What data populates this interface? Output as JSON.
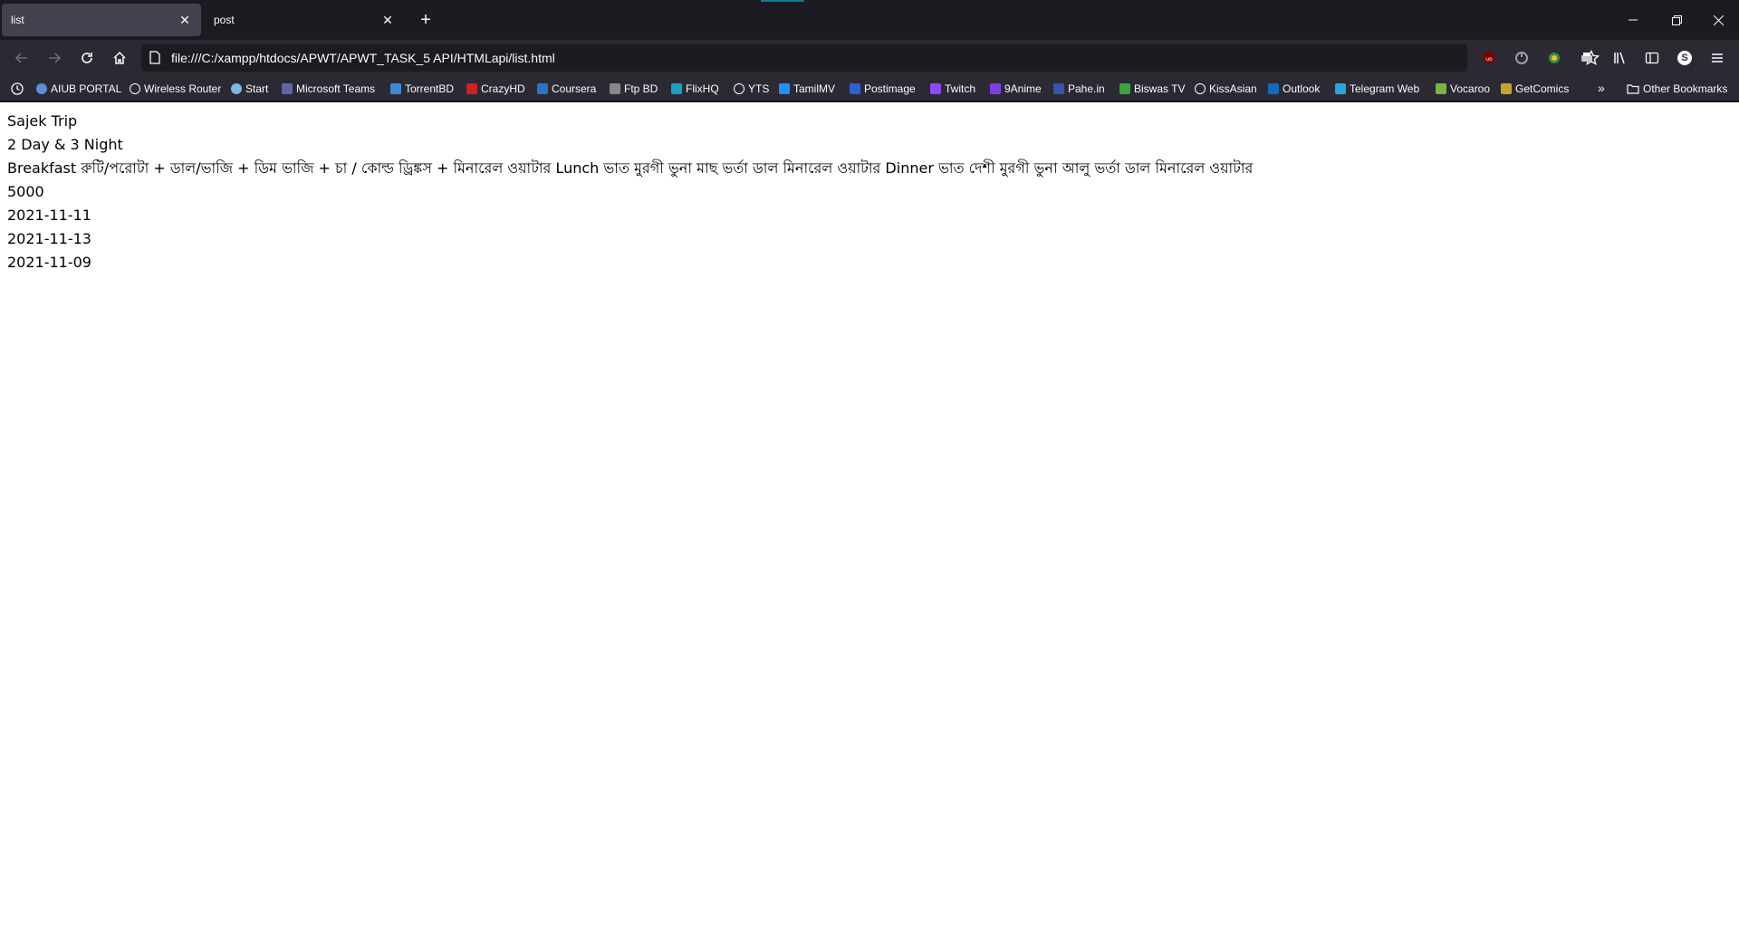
{
  "tabs": [
    {
      "title": "list",
      "active": true
    },
    {
      "title": "post",
      "active": false
    }
  ],
  "url": "file:///C:/xampp/htdocs/APWT/APWT_TASK_5 API/HTMLapi/list.html",
  "bookmarks": [
    {
      "label": "AIUB PORTAL",
      "icon": "shield-icon",
      "color": "#5b8fd6"
    },
    {
      "label": "Wireless Router",
      "icon": "globe-icon",
      "color": "#fbfbfe"
    },
    {
      "label": "Start",
      "icon": "shield-icon",
      "color": "#7fb6e8"
    },
    {
      "label": "Microsoft Teams",
      "icon": "teams-icon",
      "color": "#6264a7"
    },
    {
      "label": "TorrentBD",
      "icon": "torrentbd-icon",
      "color": "#3b8ad9"
    },
    {
      "label": "CrazyHD",
      "icon": "crazyhd-icon",
      "color": "#cc2222"
    },
    {
      "label": "Coursera",
      "icon": "coursera-icon",
      "color": "#2a73cc"
    },
    {
      "label": "Ftp BD",
      "icon": "ftpbd-icon",
      "color": "#888888"
    },
    {
      "label": "FlixHQ",
      "icon": "flixhq-icon",
      "color": "#1ba1c4"
    },
    {
      "label": "YTS",
      "icon": "globe-icon",
      "color": "#fbfbfe"
    },
    {
      "label": "TamilMV",
      "icon": "tamilmv-icon",
      "color": "#1e90ff"
    },
    {
      "label": "Postimage",
      "icon": "postimage-icon",
      "color": "#2f5fd0"
    },
    {
      "label": "Twitch",
      "icon": "twitch-icon",
      "color": "#9146ff"
    },
    {
      "label": "9Anime",
      "icon": "play-icon",
      "color": "#7b3fe4"
    },
    {
      "label": "Pahe.in",
      "icon": "pahe-icon",
      "color": "#3355aa"
    },
    {
      "label": "Biswas TV",
      "icon": "biswastv-icon",
      "color": "#3aa53a"
    },
    {
      "label": "KissAsian",
      "icon": "globe-icon",
      "color": "#fbfbfe"
    },
    {
      "label": "Outlook",
      "icon": "outlook-icon",
      "color": "#0f6cbd"
    },
    {
      "label": "Telegram Web",
      "icon": "telegram-icon",
      "color": "#2aa3e0"
    },
    {
      "label": "Vocaroo",
      "icon": "vocaroo-icon",
      "color": "#7cb342"
    },
    {
      "label": "GetComics",
      "icon": "getcomics-icon",
      "color": "#c9a227"
    }
  ],
  "other_bookmarks": "Other Bookmarks",
  "content": {
    "lines": [
      "Sajek Trip",
      "2 Day & 3 Night",
      "Breakfast রুটি/পরোটা + ডাল/ভাজি + ডিম ভাজি + চা / কোল্ড ড্রিঙ্কস + মিনারেল ওয়াটার Lunch ভাত মুরগী ভুনা মাছ ভর্তা ডাল মিনারেল ওয়াটার Dinner ভাত দেশী মুরগী ভুনা আলু ভর্তা ডাল মিনারেল ওয়াটার",
      "5000",
      "2021-11-11",
      "2021-11-13",
      "2021-11-09"
    ]
  },
  "account_initial": "S"
}
